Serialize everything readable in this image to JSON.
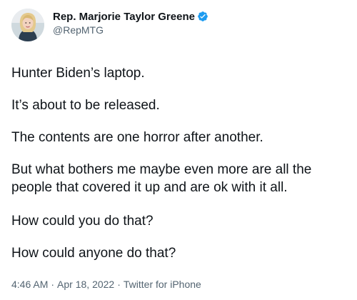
{
  "author": {
    "display_name": "Rep. Marjorie Taylor Greene",
    "handle": "@RepMTG",
    "verified": true,
    "avatar_icon": "profile-photo",
    "verified_icon": "verified-badge-icon",
    "verified_color": "#1d9bf0"
  },
  "tweet": {
    "paragraphs": [
      "Hunter Biden’s laptop.",
      "It’s about to be released.",
      "The contents are one horror after another.",
      "But what bothers me maybe even more are all the people that covered it up and are ok with it all.",
      "How could you do that?",
      "How could anyone do that?"
    ]
  },
  "meta": {
    "time": "4:46 AM",
    "date": "Apr 18, 2022",
    "source": "Twitter for iPhone",
    "separator": "·"
  },
  "colors": {
    "text_primary": "#0f1419",
    "text_secondary": "#536471",
    "background": "#ffffff"
  }
}
